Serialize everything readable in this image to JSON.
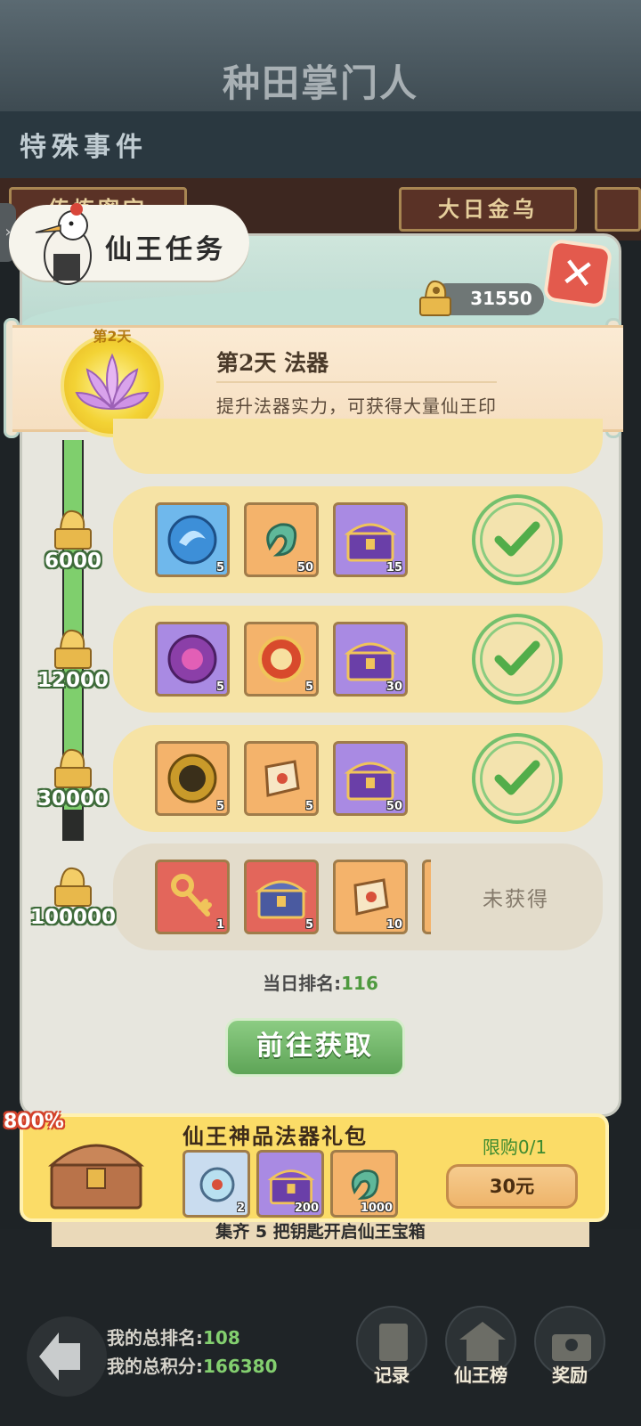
{
  "background": {
    "logo": "种田掌门人",
    "section_title": "特殊事件",
    "tabs": [
      "传炼密宝",
      "大日金乌"
    ],
    "scroll_text": "集齐 5 把钥匙开启仙王宝箱"
  },
  "panel": {
    "title": "仙王任务",
    "token_balance": "31550"
  },
  "day_banner": {
    "badge": "第2天",
    "title": "第2天  法器",
    "description": "提升法器实力，可获得大量仙王印"
  },
  "milestones": [
    {
      "value": "6000",
      "claimed": true,
      "items": [
        {
          "icon": "blue-dragon-orb-icon",
          "color": "blue",
          "count": "5"
        },
        {
          "icon": "jade-dragon-icon",
          "color": "orange",
          "count": "50"
        },
        {
          "icon": "treasure-chest-icon",
          "color": "purple",
          "count": "15"
        }
      ]
    },
    {
      "value": "12000",
      "claimed": true,
      "items": [
        {
          "icon": "purple-orb-icon",
          "color": "purple",
          "count": "5"
        },
        {
          "icon": "fortune-orb-icon",
          "color": "orange",
          "count": "5"
        },
        {
          "icon": "treasure-chest-icon",
          "color": "purple",
          "count": "30"
        }
      ]
    },
    {
      "value": "30000",
      "claimed": true,
      "items": [
        {
          "icon": "golden-medallion-icon",
          "color": "orange",
          "count": "5"
        },
        {
          "icon": "scroll-talisman-icon",
          "color": "orange",
          "count": "5"
        },
        {
          "icon": "treasure-chest-icon",
          "color": "purple",
          "count": "50"
        }
      ]
    },
    {
      "value": "100000",
      "claimed": false,
      "items": [
        {
          "icon": "golden-key-icon",
          "color": "red",
          "count": "1"
        },
        {
          "icon": "treasure-chest-icon",
          "color": "red",
          "count": "5"
        },
        {
          "icon": "scroll-talisman-icon",
          "color": "orange",
          "count": "10"
        }
      ]
    }
  ],
  "unobtained_label": "未获得",
  "daily_rank": {
    "label": "当日排名:",
    "value": "116"
  },
  "go_button": "前往获取",
  "gift_pack": {
    "badge": "800%",
    "title": "仙王神品法器礼包",
    "limit": "限购0/1",
    "price": "30元",
    "items": [
      {
        "icon": "ornament-icon",
        "count": "2"
      },
      {
        "icon": "treasure-chest-icon",
        "count": "200"
      },
      {
        "icon": "jade-dragon-icon",
        "count": "1000"
      }
    ]
  },
  "footer": {
    "total_rank_label": "我的总排名:",
    "total_rank_value": "108",
    "total_score_label": "我的总积分:",
    "total_score_value": "166380",
    "nav": [
      "记录",
      "仙王榜",
      "奖励"
    ]
  }
}
